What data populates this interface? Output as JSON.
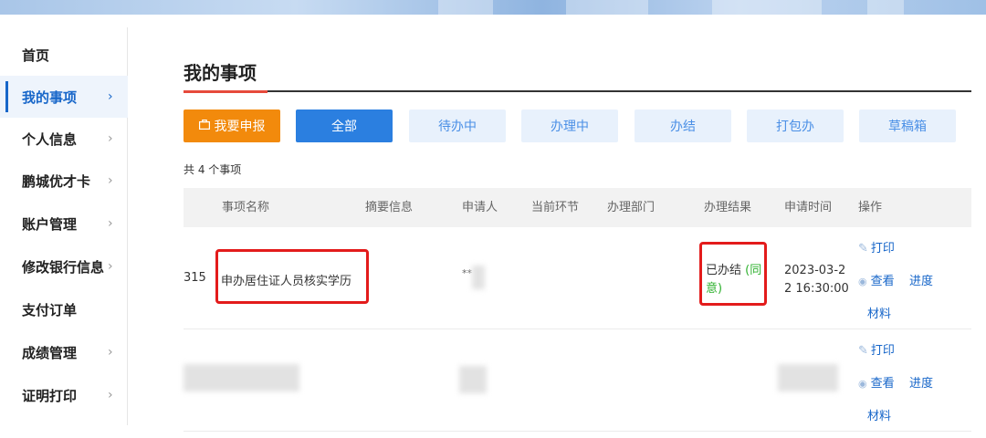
{
  "sidebar": {
    "items": [
      {
        "label": "首页",
        "chevron": false,
        "active": false
      },
      {
        "label": "我的事项",
        "chevron": true,
        "active": true
      },
      {
        "label": "个人信息",
        "chevron": true,
        "active": false
      },
      {
        "label": "鹏城优才卡",
        "chevron": true,
        "active": false
      },
      {
        "label": "账户管理",
        "chevron": true,
        "active": false
      },
      {
        "label": "修改银行信息",
        "chevron": true,
        "active": false
      },
      {
        "label": "支付订单",
        "chevron": false,
        "active": false
      },
      {
        "label": "成绩管理",
        "chevron": true,
        "active": false
      },
      {
        "label": "证明打印",
        "chevron": true,
        "active": false
      }
    ],
    "chevron_glyph": "›"
  },
  "main": {
    "title": "我的事项",
    "tabs": {
      "apply": "我要申报",
      "all": "全部",
      "pending": "待办中",
      "processing": "办理中",
      "done": "办结",
      "bundle": "打包办",
      "drafts": "草稿箱"
    },
    "count_text": "共 4 个事项",
    "table": {
      "headers": {
        "name": "事项名称",
        "summary": "摘要信息",
        "applicant": "申请人",
        "step": "当前环节",
        "dept": "办理部门",
        "result": "办理结果",
        "time": "申请时间",
        "ops": "操作"
      },
      "row1": {
        "id_suffix": "315",
        "name": "申办居住证人员核实学历",
        "applicant": "**",
        "result_main": "已办结",
        "result_paren": "(同意)",
        "time_line1": "2023-03-2",
        "time_line2": "2 16:30:00",
        "op_print": "打印",
        "op_view": "查看",
        "op_progress": "进度",
        "op_material": "材料"
      },
      "row2": {
        "op_print": "打印",
        "op_view": "查看",
        "op_progress": "进度",
        "op_material": "材料"
      }
    }
  },
  "colors": {
    "brand_blue": "#2b7fe0",
    "apply_orange": "#f28a0c",
    "highlight_red": "#e31b1b",
    "result_green": "#2fb12f"
  }
}
